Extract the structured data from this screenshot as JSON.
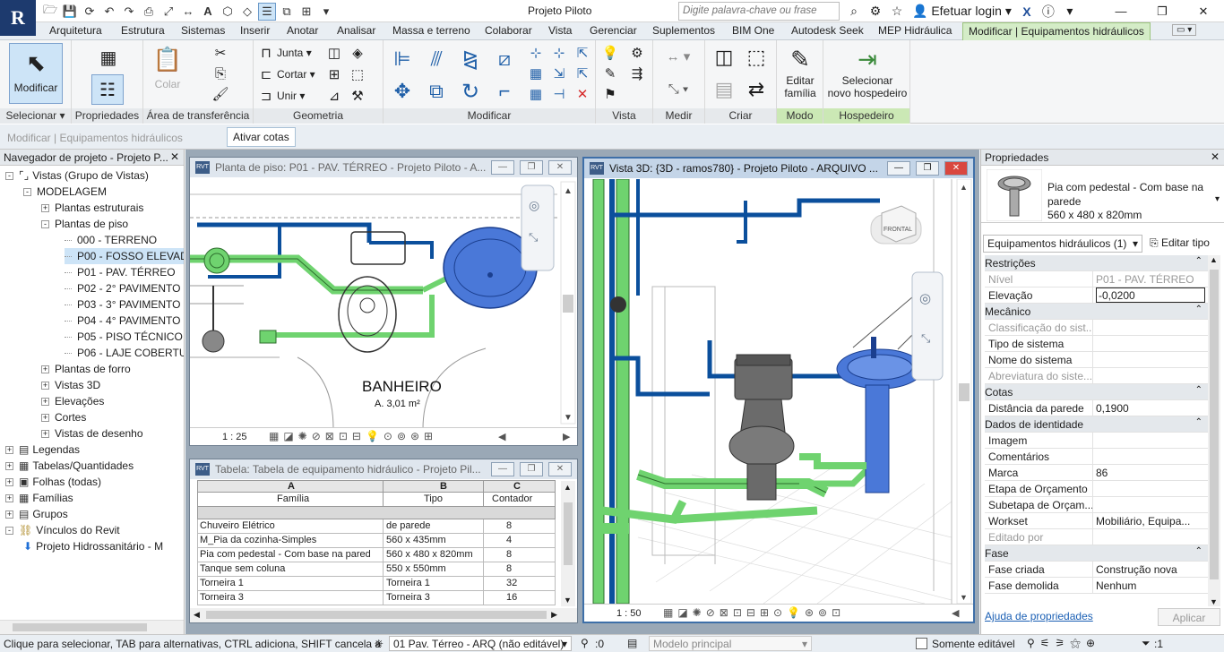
{
  "app": {
    "logo": "R",
    "title": "Projeto Piloto",
    "search_placeholder": "Digite palavra-chave ou frase",
    "login": "Efetuar login",
    "help": "?"
  },
  "tabs": [
    "Arquitetura",
    "Estrutura",
    "Sistemas",
    "Inserir",
    "Anotar",
    "Analisar",
    "Massa e terreno",
    "Colaborar",
    "Vista",
    "Gerenciar",
    "Suplementos",
    "BIM One",
    "Autodesk Seek",
    "MEP Hidráulica",
    "Modificar | Equipamentos hidráulicos"
  ],
  "ribbon": {
    "panels": {
      "selecionar": "Selecionar",
      "propriedades": "Propriedades",
      "transferencia": "Área de transferência",
      "geometria": "Geometria",
      "modificar": "Modificar",
      "vista": "Vista",
      "medir": "Medir",
      "criar": "Criar",
      "modo": "Modo",
      "hospedeiro": "Hospedeiro"
    },
    "modificar_btn": "Modificar",
    "colar_btn": "Colar",
    "junta": "Junta",
    "cortar": "Cortar",
    "unir": "Unir",
    "editar_familia_1": "Editar",
    "editar_familia_2": "família",
    "selecionar_hosp_1": "Selecionar",
    "selecionar_hosp_2": "novo hospedeiro"
  },
  "options_bar": {
    "context": "Modificar | Equipamentos hidráulicos",
    "button": "Ativar cotas"
  },
  "browser": {
    "title": "Navegador de projeto - Projeto P...",
    "items": [
      {
        "label": "Vistas (Grupo de Vistas)",
        "level": 0,
        "exp": "-"
      },
      {
        "label": "MODELAGEM",
        "level": 1,
        "exp": "-"
      },
      {
        "label": "Plantas estruturais",
        "level": 2,
        "exp": "+"
      },
      {
        "label": "Plantas de piso",
        "level": 2,
        "exp": "-"
      },
      {
        "label": "000 - TERRENO",
        "level": 3,
        "exp": ""
      },
      {
        "label": "P00 - FOSSO ELEVADOR",
        "level": 3,
        "exp": ""
      },
      {
        "label": "P01 - PAV. TÉRREO",
        "level": 3,
        "exp": ""
      },
      {
        "label": "P02 - 2° PAVIMENTO",
        "level": 3,
        "exp": ""
      },
      {
        "label": "P03 - 3° PAVIMENTO",
        "level": 3,
        "exp": ""
      },
      {
        "label": "P04 - 4° PAVIMENTO",
        "level": 3,
        "exp": ""
      },
      {
        "label": "P05 - PISO TÉCNICO",
        "level": 3,
        "exp": ""
      },
      {
        "label": "P06 - LAJE COBERTURA",
        "level": 3,
        "exp": ""
      },
      {
        "label": "Plantas de forro",
        "level": 2,
        "exp": "+"
      },
      {
        "label": "Vistas 3D",
        "level": 2,
        "exp": "+"
      },
      {
        "label": "Elevações",
        "level": 2,
        "exp": "+"
      },
      {
        "label": "Cortes",
        "level": 2,
        "exp": "+"
      },
      {
        "label": "Vistas de desenho",
        "level": 2,
        "exp": "+"
      },
      {
        "label": "Legendas",
        "level": 0,
        "exp": "+"
      },
      {
        "label": "Tabelas/Quantidades",
        "level": 0,
        "exp": "+"
      },
      {
        "label": "Folhas (todas)",
        "level": 0,
        "exp": "+"
      },
      {
        "label": "Famílias",
        "level": 0,
        "exp": "+"
      },
      {
        "label": "Grupos",
        "level": 0,
        "exp": "+"
      },
      {
        "label": "Vínculos do Revit",
        "level": 0,
        "exp": "-"
      },
      {
        "label": "Projeto Hidrossanitário - M",
        "level": 1,
        "exp": ""
      }
    ]
  },
  "floor_plan": {
    "title": "Planta de piso: P01 - PAV. TÉRREO - Projeto Piloto - A...",
    "room_name": "BANHEIRO",
    "room_area": "A. 3,01 m²",
    "scale": "1 : 25"
  },
  "schedule": {
    "title": "Tabela: Tabela de equipamento hidráulico - Projeto Pil...",
    "col_letters": [
      "A",
      "B",
      "C"
    ],
    "headers": [
      "Família",
      "Tipo",
      "Contador"
    ],
    "rows": [
      [
        "Chuveiro Elétrico",
        "de parede",
        "8"
      ],
      [
        "M_Pia da cozinha-Simples",
        "560 x 435mm",
        "4"
      ],
      [
        "Pia com pedestal - Com base na pared",
        "560 x 480 x 820mm",
        "8"
      ],
      [
        "Tanque sem coluna",
        "550 x 550mm",
        "8"
      ],
      [
        "Torneira 1",
        "Torneira 1",
        "32"
      ],
      [
        "Torneira 3",
        "Torneira 3",
        "16"
      ]
    ]
  },
  "view3d": {
    "title": "Vista 3D: {3D - ramos780} - Projeto Piloto - ARQUIVO ...",
    "scale": "1 : 50",
    "cube_label": "FRONTAL"
  },
  "properties": {
    "title": "Propriedades",
    "type_name": "Pia com pedestal - Com base na parede",
    "type_size": "560 x 480 x 820mm",
    "selector": "Equipamentos hidráulicos (1)",
    "edit_type": "Editar tipo",
    "groups": [
      {
        "name": "Restrições",
        "rows": [
          [
            "Nível",
            "P01 - PAV. TÉRREO",
            true
          ],
          [
            "Elevação",
            "-0,0200",
            false
          ]
        ]
      },
      {
        "name": "Mecânico",
        "rows": [
          [
            "Classificação do sist...",
            "",
            true
          ],
          [
            "Tipo de sistema",
            "",
            false
          ],
          [
            "Nome do sistema",
            "",
            false
          ],
          [
            "Abreviatura do siste...",
            "",
            true
          ]
        ]
      },
      {
        "name": "Cotas",
        "rows": [
          [
            "Distância da parede",
            "0,1900",
            false
          ]
        ]
      },
      {
        "name": "Dados de identidade",
        "rows": [
          [
            "Imagem",
            "",
            false
          ],
          [
            "Comentários",
            "",
            false
          ],
          [
            "Marca",
            "86",
            false
          ],
          [
            "Etapa de Orçamento",
            "",
            false
          ],
          [
            "Subetapa de Orçam...",
            "",
            false
          ],
          [
            "Workset",
            "Mobiliário, Equipa...",
            false
          ],
          [
            "Editado por",
            "",
            true
          ]
        ]
      },
      {
        "name": "Fase",
        "rows": [
          [
            "Fase criada",
            "Construção nova",
            false
          ],
          [
            "Fase demolida",
            "Nenhum",
            false
          ]
        ]
      }
    ],
    "help_link": "Ajuda de propriedades",
    "apply": "Aplicar"
  },
  "status": {
    "message": "Clique para selecionar, TAB para alternativas, CTRL adiciona, SHIFT cancela a",
    "workset": "01 Pav. Térreo - ARQ (não editável)",
    "count": ":0",
    "model": "Modelo principal",
    "editable_only": "Somente editável",
    "filter_count": ":1"
  },
  "colors": {
    "accent": "#1d3a6e",
    "pipe_green": "#6fd36f",
    "pipe_blue": "#0b4f9c",
    "selected_blue": "#4a78d8",
    "contextual_tab": "#d4ecc7"
  }
}
